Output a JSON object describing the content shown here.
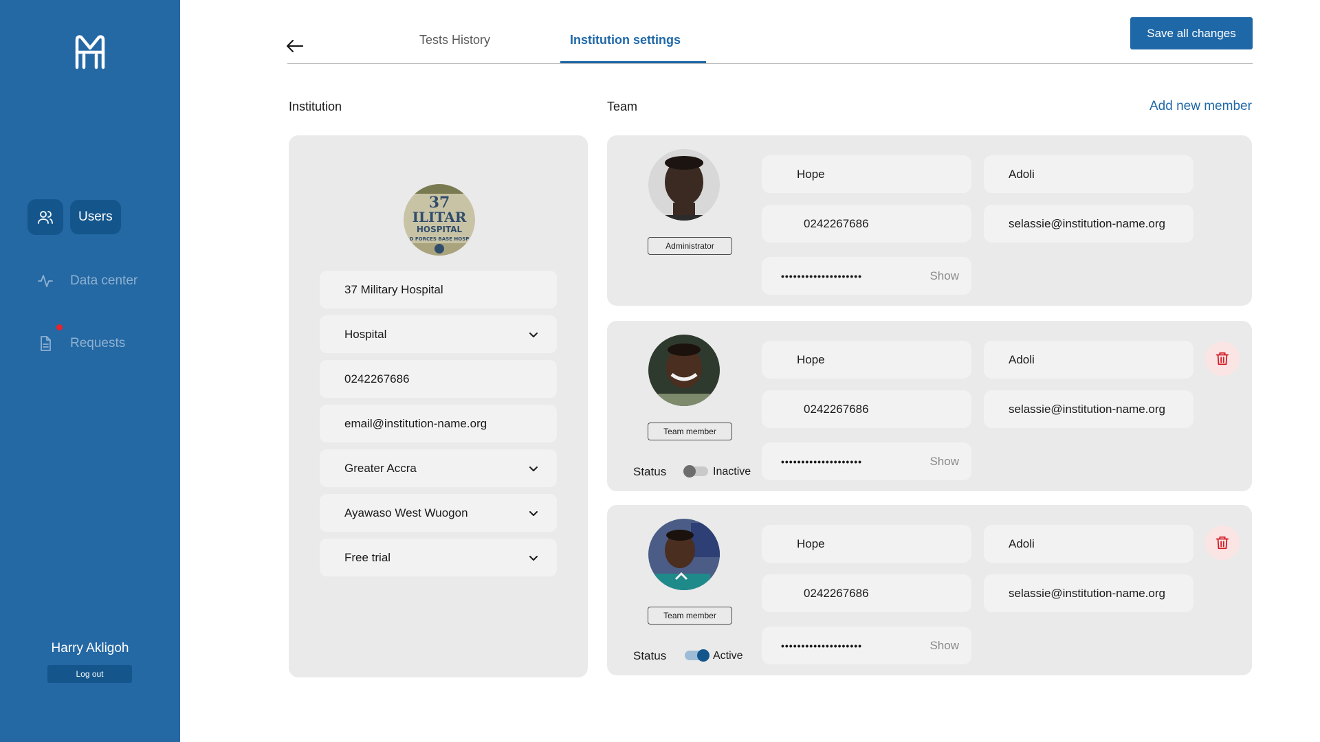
{
  "sidebar": {
    "nav": [
      {
        "label": "Users",
        "icon": "users-icon",
        "active": true
      },
      {
        "label": "Data center",
        "icon": "activity-icon",
        "active": false
      },
      {
        "label": "Requests",
        "icon": "document-icon",
        "active": false,
        "notification": true
      }
    ],
    "user_name": "Harry Akligoh",
    "logout_label": "Log out"
  },
  "header": {
    "tabs": [
      {
        "label": "Tests History",
        "active": false
      },
      {
        "label": "Institution settings",
        "active": true
      }
    ],
    "save_label": "Save all changes"
  },
  "institution": {
    "title": "Institution",
    "avatar_text": [
      "37",
      "ILITAR",
      "HOSPITAL",
      "D FORCES BASE HOSP"
    ],
    "name": "37 Military Hospital",
    "type": "Hospital",
    "phone": "0242267686",
    "email": "email@institution-name.org",
    "region": "Greater Accra",
    "district": "Ayawaso West Wuogon",
    "plan": "Free trial"
  },
  "team": {
    "title": "Team",
    "add_label": "Add new member",
    "status_label": "Status",
    "show_label": "Show",
    "members": [
      {
        "role": "Administrator",
        "first_name": "Hope",
        "last_name": "Adoli",
        "phone": "0242267686",
        "email": "selassie@institution-name.org",
        "password_mask": "••••••••••••••••••••"
      },
      {
        "role": "Team member",
        "first_name": "Hope",
        "last_name": "Adoli",
        "phone": "0242267686",
        "email": "selassie@institution-name.org",
        "password_mask": "••••••••••••••••••••",
        "status": "Inactive"
      },
      {
        "role": "Team member",
        "first_name": "Hope",
        "last_name": "Adoli",
        "phone": "0242267686",
        "email": "selassie@institution-name.org",
        "password_mask": "••••••••••••••••••••",
        "status": "Active"
      }
    ]
  },
  "colors": {
    "sidebar": "#2468a4",
    "accent": "#1f68a8",
    "active_nav": "#14568c",
    "card": "#eaeaea",
    "danger": "#d21f26"
  }
}
